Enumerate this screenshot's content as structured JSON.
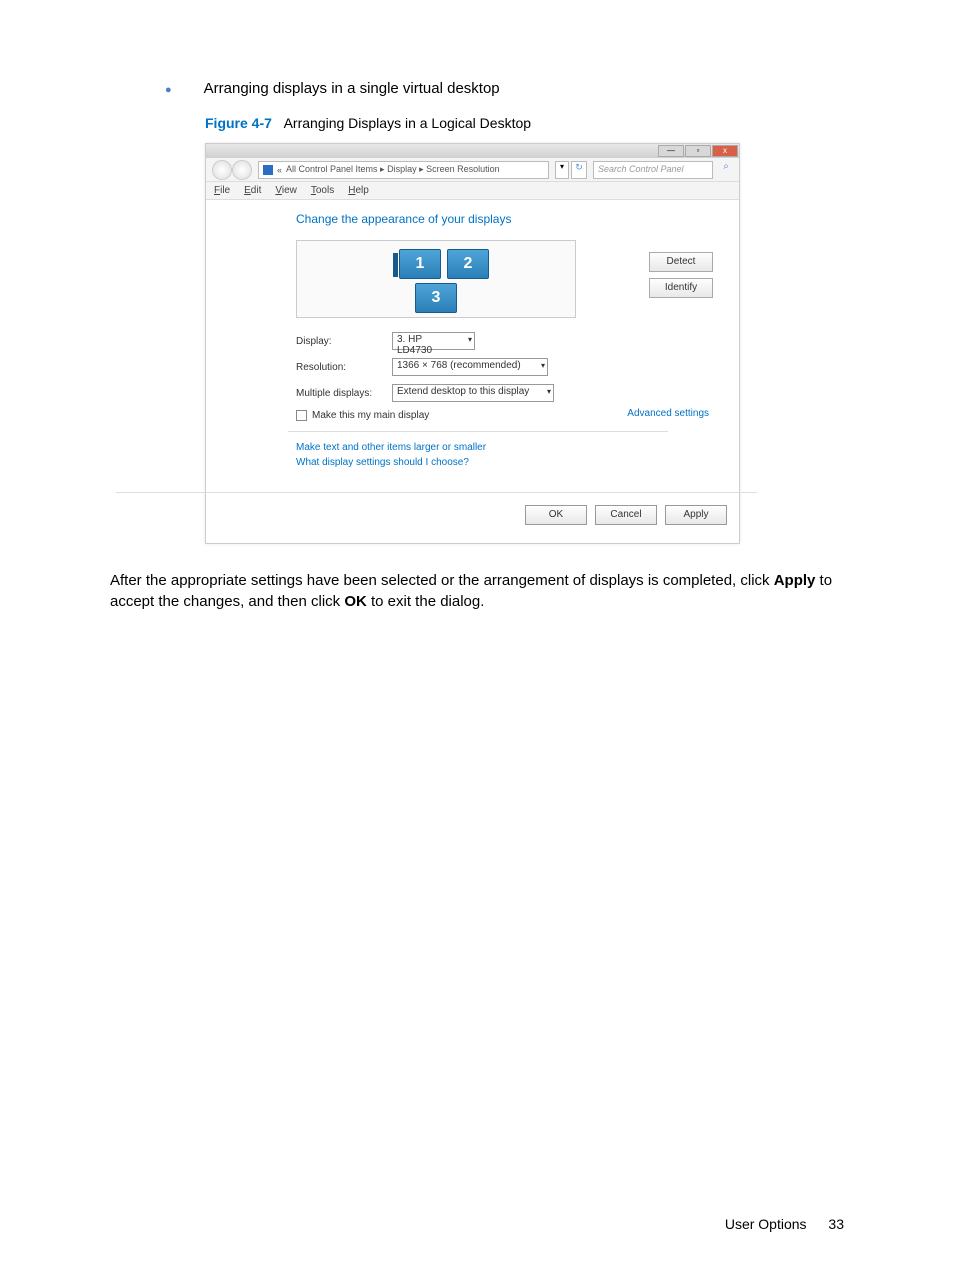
{
  "bullet_text": "Arranging displays in a single virtual desktop",
  "figure": {
    "label": "Figure 4-7",
    "desc": "Arranging Displays in a Logical Desktop"
  },
  "titlebar": {
    "min": "—",
    "max": "▫",
    "close": "x"
  },
  "nav": {
    "back_chevrons": "«",
    "path": "All Control Panel Items  ▸  Display  ▸  Screen Resolution",
    "down": "▾",
    "refresh": "↻",
    "search_placeholder": "Search Control Panel",
    "search_icon": "⌕"
  },
  "menu": {
    "file": "File",
    "edit": "Edit",
    "view": "View",
    "tools": "Tools",
    "help": "Help"
  },
  "section_title": "Change the appearance of your displays",
  "displays": {
    "d1": "1",
    "d2": "2",
    "d3": "3"
  },
  "side_buttons": {
    "detect": "Detect",
    "identify": "Identify"
  },
  "form": {
    "display_label": "Display:",
    "display_value": "3. HP LD4730",
    "resolution_label": "Resolution:",
    "resolution_value": "1366 × 768 (recommended)",
    "multiple_label": "Multiple displays:",
    "multiple_value": "Extend desktop to this display"
  },
  "checkbox_label": "Make this my main display",
  "advanced_link": "Advanced settings",
  "link1": "Make text and other items larger or smaller",
  "link2": "What display settings should I choose?",
  "buttons": {
    "ok": "OK",
    "cancel": "Cancel",
    "apply": "Apply"
  },
  "post_text": {
    "part1": "After the appropriate settings have been selected or the arrangement of displays is completed, click ",
    "apply": "Apply",
    "part2": " to accept the changes, and then click ",
    "ok": "OK",
    "part3": " to exit the dialog."
  },
  "footer": {
    "section": "User Options",
    "page": "33"
  }
}
